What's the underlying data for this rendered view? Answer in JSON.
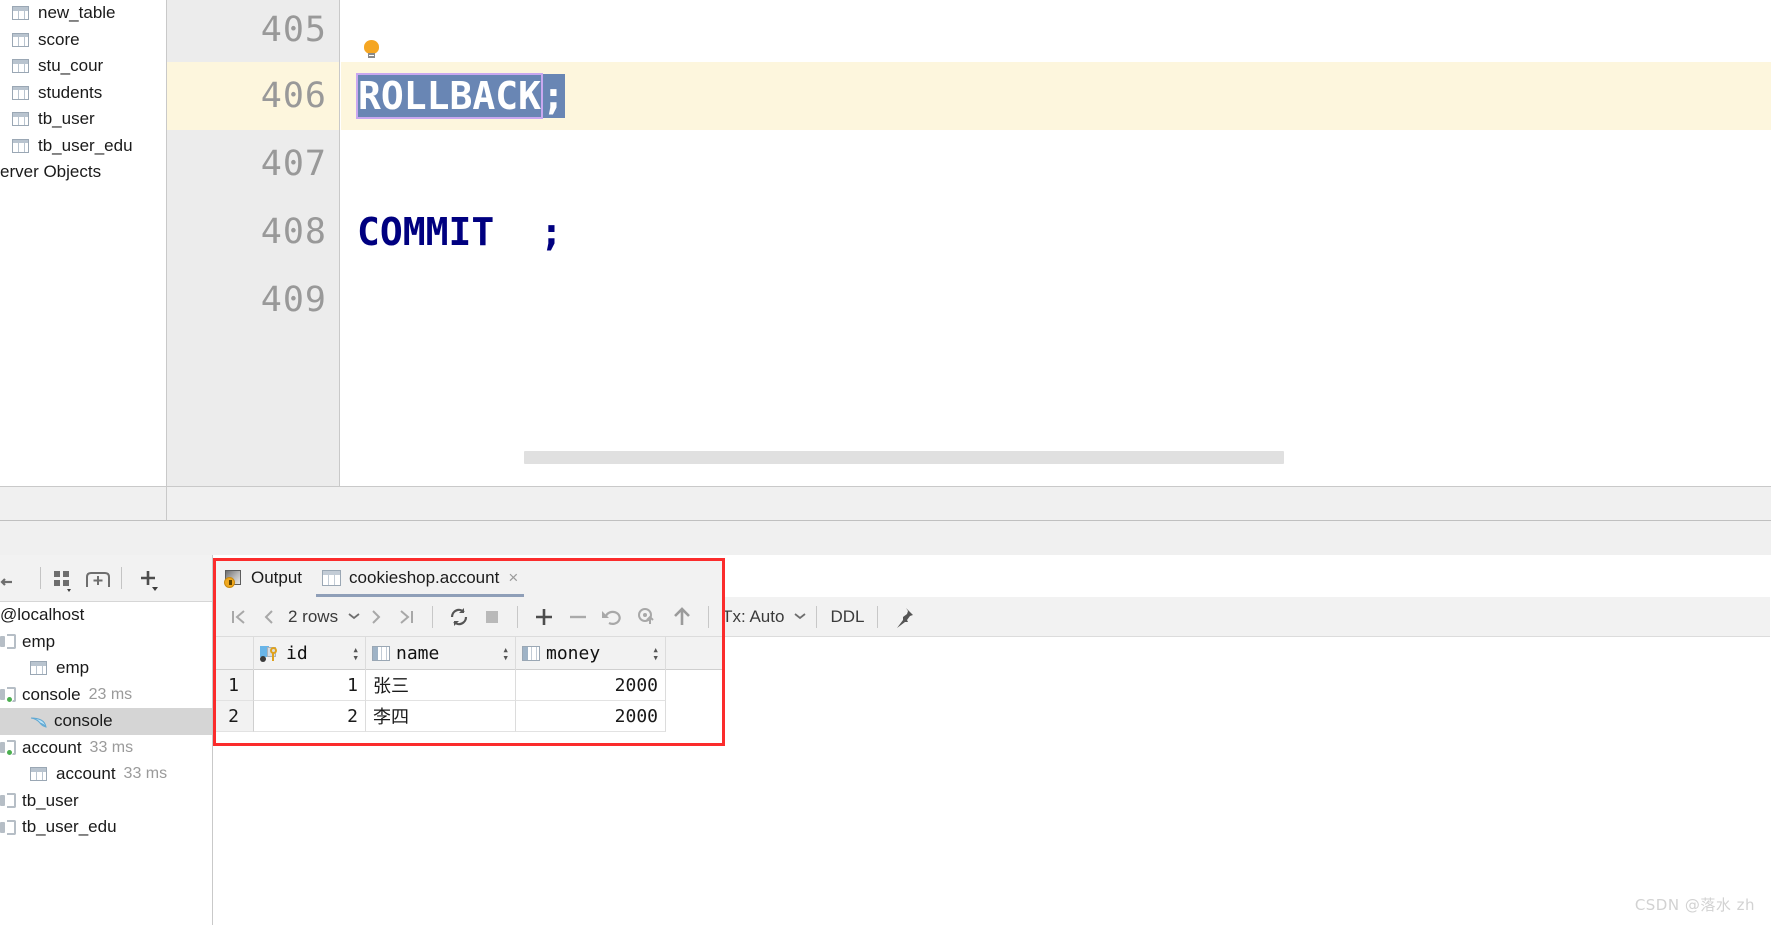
{
  "database_tree_top": {
    "items": [
      {
        "label": "new_table",
        "icon": "table-icon"
      },
      {
        "label": "score",
        "icon": "table-icon"
      },
      {
        "label": "stu_cour",
        "icon": "table-icon"
      },
      {
        "label": "students",
        "icon": "table-icon"
      },
      {
        "label": "tb_user",
        "icon": "table-icon"
      },
      {
        "label": "tb_user_edu",
        "icon": "table-icon"
      },
      {
        "label": "erver Objects",
        "icon": "none"
      }
    ]
  },
  "editor": {
    "line_numbers": [
      "405",
      "406",
      "407",
      "408",
      "409"
    ],
    "highlighted_line": "406",
    "lines": [
      {
        "num": "405",
        "text": ""
      },
      {
        "num": "406",
        "text": "ROLLBACK;",
        "selected_token": "ROLLBACK",
        "trailing": ";"
      },
      {
        "num": "407",
        "text": ""
      },
      {
        "num": "408",
        "text": "COMMIT  ;"
      },
      {
        "num": "409",
        "text": ""
      }
    ],
    "intention_bulb": "lightbulb-icon",
    "colors": {
      "keyword": "#000080",
      "selection_bg": "#6986b4",
      "selection_border": "#c9a8f0",
      "caret_line_bg": "#fdf6dd",
      "gutter_bg": "#ececec"
    }
  },
  "services_toolbar": {
    "icons": [
      "expand-icon",
      "group-icon",
      "add-tab-icon",
      "add-icon"
    ]
  },
  "services_tree": {
    "items": [
      {
        "label": "@localhost",
        "icon": "none",
        "indent": 0,
        "time": "",
        "selected": false
      },
      {
        "label": "emp",
        "icon": "db-icon",
        "indent": 1,
        "time": "",
        "selected": false
      },
      {
        "label": "emp",
        "icon": "table-icon",
        "indent": 2,
        "time": "",
        "selected": false
      },
      {
        "label": "console",
        "icon": "db-icon-live",
        "indent": 1,
        "time": "23 ms",
        "selected": false
      },
      {
        "label": "console",
        "icon": "dolphin-icon",
        "indent": 2,
        "time": "",
        "selected": true
      },
      {
        "label": "account",
        "icon": "db-icon-live",
        "indent": 1,
        "time": "33 ms",
        "selected": false
      },
      {
        "label": "account",
        "icon": "table-icon",
        "indent": 2,
        "time": "33 ms",
        "selected": false
      },
      {
        "label": "tb_user",
        "icon": "db-icon",
        "indent": 1,
        "time": "",
        "selected": false
      },
      {
        "label": "tb_user_edu",
        "icon": "db-icon",
        "indent": 1,
        "time": "",
        "selected": false
      }
    ]
  },
  "results": {
    "tabs": [
      {
        "label": "Output",
        "icon": "output-icon",
        "active": false,
        "closable": false
      },
      {
        "label": "cookieshop.account",
        "icon": "grid-icon",
        "active": true,
        "closable": true
      }
    ],
    "close_glyph": "×",
    "toolbar": {
      "first_page": "❘⟨",
      "prev_page": "‹",
      "row_count": "2 rows",
      "row_count_caret": "˅",
      "next_page": "›",
      "last_page": "⟩❘",
      "reload": "↻",
      "stop": "■",
      "add_row": "+",
      "remove_row": "−",
      "revert": "↺",
      "view_query": "view-query-icon",
      "submit": "↑",
      "tx_label": "Tx: Auto",
      "tx_caret": "˅",
      "ddl_label": "DDL",
      "pin": "pin-icon"
    },
    "grid": {
      "columns": [
        {
          "key": "rownum",
          "label": "",
          "icon": "none"
        },
        {
          "key": "id",
          "label": "id",
          "icon": "primary-key-icon"
        },
        {
          "key": "name",
          "label": "name",
          "icon": "column-icon"
        },
        {
          "key": "money",
          "label": "money",
          "icon": "column-icon"
        }
      ],
      "sorter_glyph_up": "▴",
      "sorter_glyph_down": "▾",
      "rows": [
        {
          "rownum": "1",
          "id": "1",
          "name": "张三",
          "money": "2000"
        },
        {
          "rownum": "2",
          "id": "2",
          "name": "李四",
          "money": "2000"
        }
      ]
    },
    "annotation_box_color": "#fb2c2c"
  },
  "watermark": {
    "text": "CSDN @落水 zh"
  }
}
